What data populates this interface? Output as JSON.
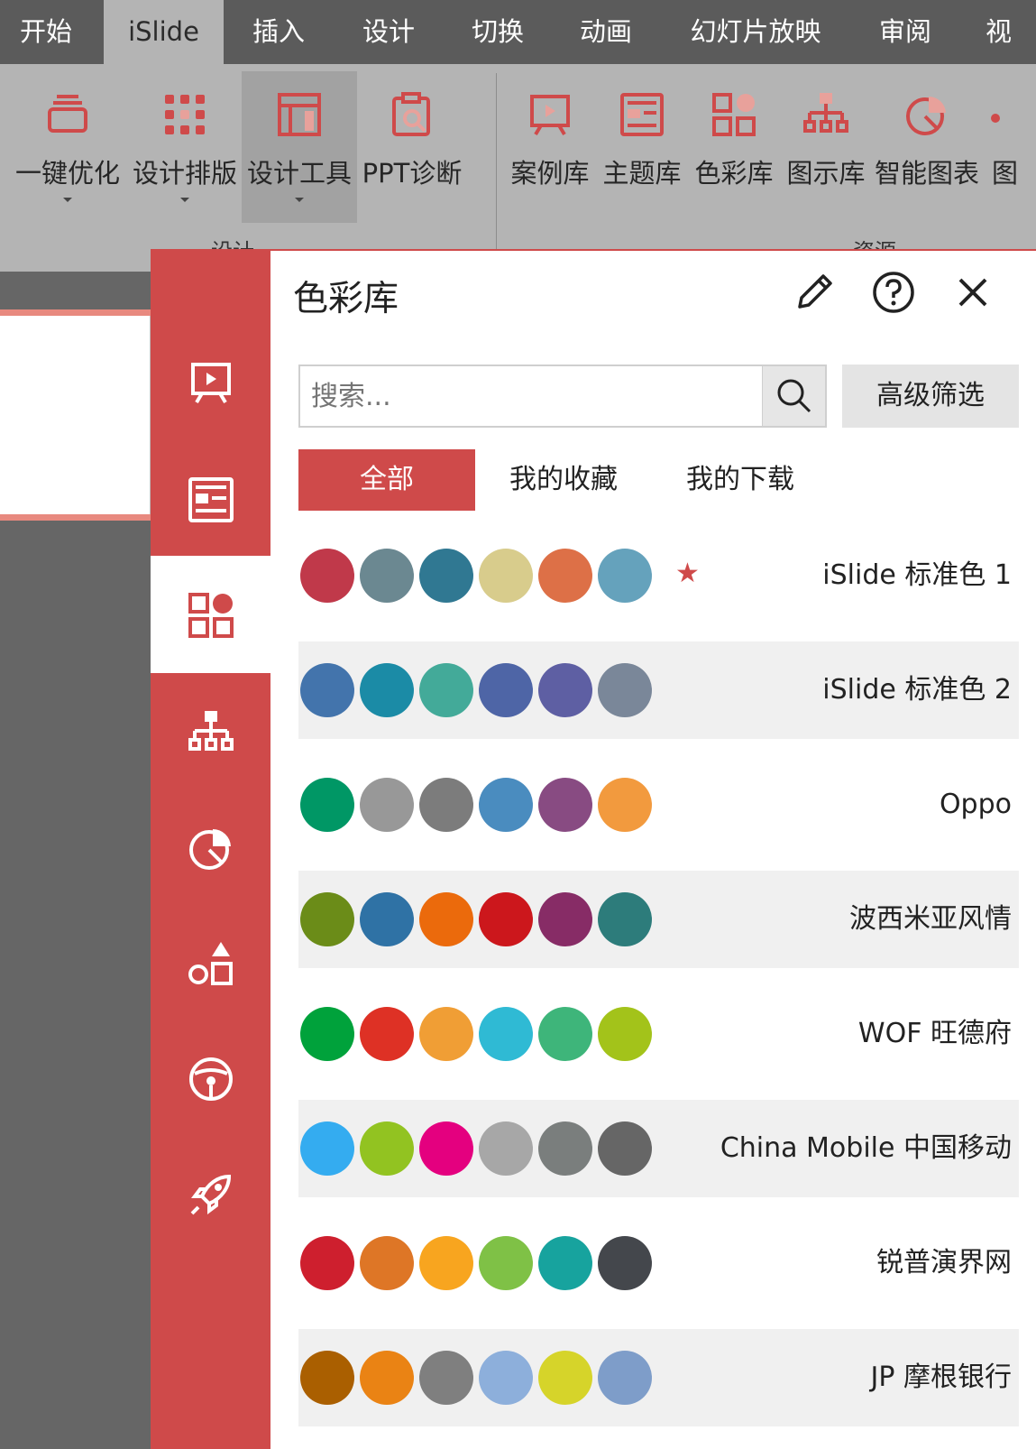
{
  "tabs": [
    "开始",
    "iSlide",
    "插入",
    "设计",
    "切换",
    "动画",
    "幻灯片放映",
    "审阅",
    "视"
  ],
  "ribbon": {
    "design_buttons": [
      {
        "label": "一键优化",
        "icon": "one-click-optimize-icon"
      },
      {
        "label": "设计排版",
        "icon": "design-layout-icon"
      },
      {
        "label": "设计工具",
        "icon": "design-tools-icon"
      },
      {
        "label": "PPT诊断",
        "icon": "ppt-diagnosis-icon"
      }
    ],
    "resource_buttons": [
      {
        "label": "案例库",
        "icon": "case-library-icon"
      },
      {
        "label": "主题库",
        "icon": "theme-library-icon"
      },
      {
        "label": "色彩库",
        "icon": "color-library-icon"
      },
      {
        "label": "图示库",
        "icon": "diagram-library-icon"
      },
      {
        "label": "智能图表",
        "icon": "smart-chart-icon"
      },
      {
        "label": "图",
        "icon": "more-icon"
      }
    ],
    "group_design": "设计",
    "group_resources": "资源"
  },
  "panel": {
    "title": "色彩库",
    "search_placeholder": "搜索...",
    "advanced_filter": "高级筛选",
    "filter_tabs": [
      "全部",
      "我的收藏",
      "我的下载"
    ],
    "sidebar_icons": [
      "case-library-icon",
      "theme-library-icon",
      "color-library-icon",
      "diagram-library-icon",
      "chart-icon",
      "shapes-icon",
      "image-library-icon",
      "rocket-icon"
    ],
    "palettes": [
      {
        "name": "iSlide 标准色 1",
        "favorite": true,
        "colors": [
          "#c0394a",
          "#6b8891",
          "#307892",
          "#d8cc8c",
          "#dd7047",
          "#65a2bc"
        ]
      },
      {
        "name": "iSlide 标准色 2",
        "favorite": false,
        "colors": [
          "#4374ac",
          "#1b8ba6",
          "#43aa99",
          "#4e65a6",
          "#5e5fa3",
          "#7a8799"
        ]
      },
      {
        "name": "Oppo",
        "favorite": false,
        "colors": [
          "#009765",
          "#989898",
          "#7c7c7c",
          "#4a8cbf",
          "#884b82",
          "#f29a3e"
        ]
      },
      {
        "name": "波西米亚风情",
        "favorite": false,
        "colors": [
          "#6b8c18",
          "#2f72a5",
          "#eb6a0c",
          "#cc171c",
          "#872c66",
          "#2d7c7b"
        ]
      },
      {
        "name": "WOF 旺德府",
        "favorite": false,
        "colors": [
          "#00a23b",
          "#de3125",
          "#f09e35",
          "#2fbad4",
          "#3eb57a",
          "#a3c31a"
        ]
      },
      {
        "name": "China Mobile 中国移动",
        "favorite": false,
        "colors": [
          "#34acf0",
          "#92c321",
          "#e4007f",
          "#a7a7a7",
          "#7a7e7d",
          "#666666"
        ]
      },
      {
        "name": "锐普演界网",
        "favorite": false,
        "colors": [
          "#ce1f2e",
          "#de7626",
          "#f8a51f",
          "#7fc146",
          "#17a39e",
          "#44474c"
        ]
      },
      {
        "name": "JP 摩根银行",
        "favorite": false,
        "colors": [
          "#aa5f00",
          "#ea8314",
          "#7f7f7f",
          "#8dafdb",
          "#d6d42a",
          "#7e9dc9"
        ]
      }
    ]
  },
  "colors": {
    "accent": "#cf4a4a",
    "tabbar": "#5b5b5b",
    "ribbon": "#b4b4b4"
  }
}
